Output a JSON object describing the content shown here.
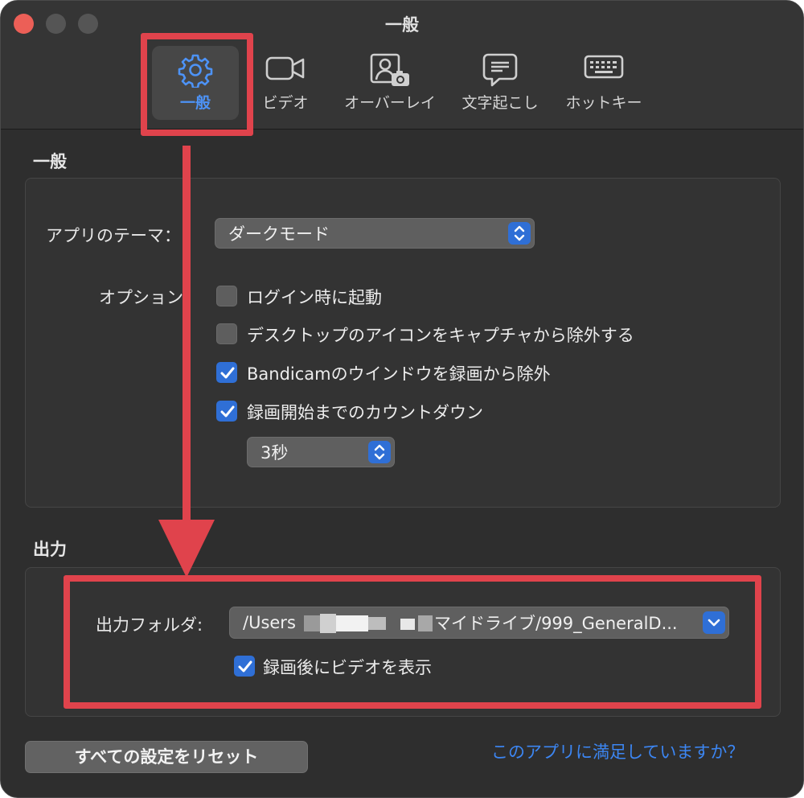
{
  "window": {
    "title": "一般"
  },
  "tabs": [
    {
      "label": "一般",
      "icon": "gear-icon",
      "active": true
    },
    {
      "label": "ビデオ",
      "icon": "video-camera-icon",
      "active": false
    },
    {
      "label": "オーバーレイ",
      "icon": "webcam-overlay-icon",
      "active": false
    },
    {
      "label": "文字起こし",
      "icon": "speech-bubble-icon",
      "active": false
    },
    {
      "label": "ホットキー",
      "icon": "keyboard-icon",
      "active": false
    }
  ],
  "general": {
    "section_title": "一般",
    "theme_label": "アプリのテーマ：",
    "theme_value": "ダークモード",
    "options_label": "オプション：",
    "options": [
      {
        "label": "ログイン時に起動",
        "checked": false
      },
      {
        "label": "デスクトップのアイコンをキャプチャから除外する",
        "checked": false
      },
      {
        "label": "Bandicamのウインドウを録画から除外",
        "checked": true
      },
      {
        "label": "録画開始までのカウントダウン",
        "checked": true
      }
    ],
    "countdown_value": "3秒"
  },
  "output": {
    "section_title": "出力",
    "folder_label": "出力フォルダ:",
    "folder_path_start": "/Users",
    "folder_path_end": "マイドライブ/999_GeneralD...",
    "show_video_label": "録画後にビデオを表示",
    "show_video_checked": true
  },
  "footer": {
    "reset_label": "すべての設定をリセット",
    "satisfaction_link": "このアプリに満足していますか？"
  },
  "colors": {
    "accent": "#2f6fd6",
    "link": "#3c86f3",
    "annotation_red": "#e0434c",
    "active_tab_text": "#4d93f7"
  }
}
